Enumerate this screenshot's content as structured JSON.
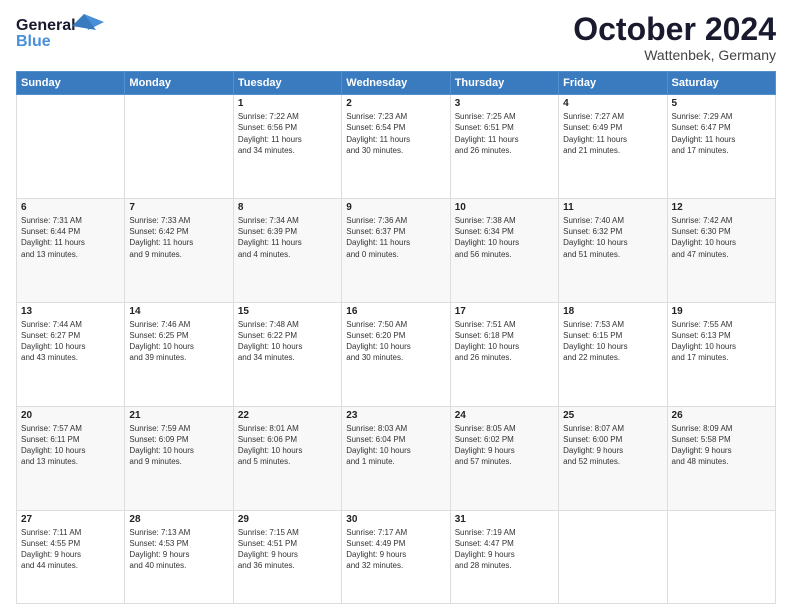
{
  "header": {
    "logo_line1": "General",
    "logo_line2": "Blue",
    "month": "October 2024",
    "location": "Wattenbek, Germany"
  },
  "days_of_week": [
    "Sunday",
    "Monday",
    "Tuesday",
    "Wednesday",
    "Thursday",
    "Friday",
    "Saturday"
  ],
  "weeks": [
    [
      {
        "day": "",
        "info": ""
      },
      {
        "day": "",
        "info": ""
      },
      {
        "day": "1",
        "info": "Sunrise: 7:22 AM\nSunset: 6:56 PM\nDaylight: 11 hours\nand 34 minutes."
      },
      {
        "day": "2",
        "info": "Sunrise: 7:23 AM\nSunset: 6:54 PM\nDaylight: 11 hours\nand 30 minutes."
      },
      {
        "day": "3",
        "info": "Sunrise: 7:25 AM\nSunset: 6:51 PM\nDaylight: 11 hours\nand 26 minutes."
      },
      {
        "day": "4",
        "info": "Sunrise: 7:27 AM\nSunset: 6:49 PM\nDaylight: 11 hours\nand 21 minutes."
      },
      {
        "day": "5",
        "info": "Sunrise: 7:29 AM\nSunset: 6:47 PM\nDaylight: 11 hours\nand 17 minutes."
      }
    ],
    [
      {
        "day": "6",
        "info": "Sunrise: 7:31 AM\nSunset: 6:44 PM\nDaylight: 11 hours\nand 13 minutes."
      },
      {
        "day": "7",
        "info": "Sunrise: 7:33 AM\nSunset: 6:42 PM\nDaylight: 11 hours\nand 9 minutes."
      },
      {
        "day": "8",
        "info": "Sunrise: 7:34 AM\nSunset: 6:39 PM\nDaylight: 11 hours\nand 4 minutes."
      },
      {
        "day": "9",
        "info": "Sunrise: 7:36 AM\nSunset: 6:37 PM\nDaylight: 11 hours\nand 0 minutes."
      },
      {
        "day": "10",
        "info": "Sunrise: 7:38 AM\nSunset: 6:34 PM\nDaylight: 10 hours\nand 56 minutes."
      },
      {
        "day": "11",
        "info": "Sunrise: 7:40 AM\nSunset: 6:32 PM\nDaylight: 10 hours\nand 51 minutes."
      },
      {
        "day": "12",
        "info": "Sunrise: 7:42 AM\nSunset: 6:30 PM\nDaylight: 10 hours\nand 47 minutes."
      }
    ],
    [
      {
        "day": "13",
        "info": "Sunrise: 7:44 AM\nSunset: 6:27 PM\nDaylight: 10 hours\nand 43 minutes."
      },
      {
        "day": "14",
        "info": "Sunrise: 7:46 AM\nSunset: 6:25 PM\nDaylight: 10 hours\nand 39 minutes."
      },
      {
        "day": "15",
        "info": "Sunrise: 7:48 AM\nSunset: 6:22 PM\nDaylight: 10 hours\nand 34 minutes."
      },
      {
        "day": "16",
        "info": "Sunrise: 7:50 AM\nSunset: 6:20 PM\nDaylight: 10 hours\nand 30 minutes."
      },
      {
        "day": "17",
        "info": "Sunrise: 7:51 AM\nSunset: 6:18 PM\nDaylight: 10 hours\nand 26 minutes."
      },
      {
        "day": "18",
        "info": "Sunrise: 7:53 AM\nSunset: 6:15 PM\nDaylight: 10 hours\nand 22 minutes."
      },
      {
        "day": "19",
        "info": "Sunrise: 7:55 AM\nSunset: 6:13 PM\nDaylight: 10 hours\nand 17 minutes."
      }
    ],
    [
      {
        "day": "20",
        "info": "Sunrise: 7:57 AM\nSunset: 6:11 PM\nDaylight: 10 hours\nand 13 minutes."
      },
      {
        "day": "21",
        "info": "Sunrise: 7:59 AM\nSunset: 6:09 PM\nDaylight: 10 hours\nand 9 minutes."
      },
      {
        "day": "22",
        "info": "Sunrise: 8:01 AM\nSunset: 6:06 PM\nDaylight: 10 hours\nand 5 minutes."
      },
      {
        "day": "23",
        "info": "Sunrise: 8:03 AM\nSunset: 6:04 PM\nDaylight: 10 hours\nand 1 minute."
      },
      {
        "day": "24",
        "info": "Sunrise: 8:05 AM\nSunset: 6:02 PM\nDaylight: 9 hours\nand 57 minutes."
      },
      {
        "day": "25",
        "info": "Sunrise: 8:07 AM\nSunset: 6:00 PM\nDaylight: 9 hours\nand 52 minutes."
      },
      {
        "day": "26",
        "info": "Sunrise: 8:09 AM\nSunset: 5:58 PM\nDaylight: 9 hours\nand 48 minutes."
      }
    ],
    [
      {
        "day": "27",
        "info": "Sunrise: 7:11 AM\nSunset: 4:55 PM\nDaylight: 9 hours\nand 44 minutes."
      },
      {
        "day": "28",
        "info": "Sunrise: 7:13 AM\nSunset: 4:53 PM\nDaylight: 9 hours\nand 40 minutes."
      },
      {
        "day": "29",
        "info": "Sunrise: 7:15 AM\nSunset: 4:51 PM\nDaylight: 9 hours\nand 36 minutes."
      },
      {
        "day": "30",
        "info": "Sunrise: 7:17 AM\nSunset: 4:49 PM\nDaylight: 9 hours\nand 32 minutes."
      },
      {
        "day": "31",
        "info": "Sunrise: 7:19 AM\nSunset: 4:47 PM\nDaylight: 9 hours\nand 28 minutes."
      },
      {
        "day": "",
        "info": ""
      },
      {
        "day": "",
        "info": ""
      }
    ]
  ]
}
